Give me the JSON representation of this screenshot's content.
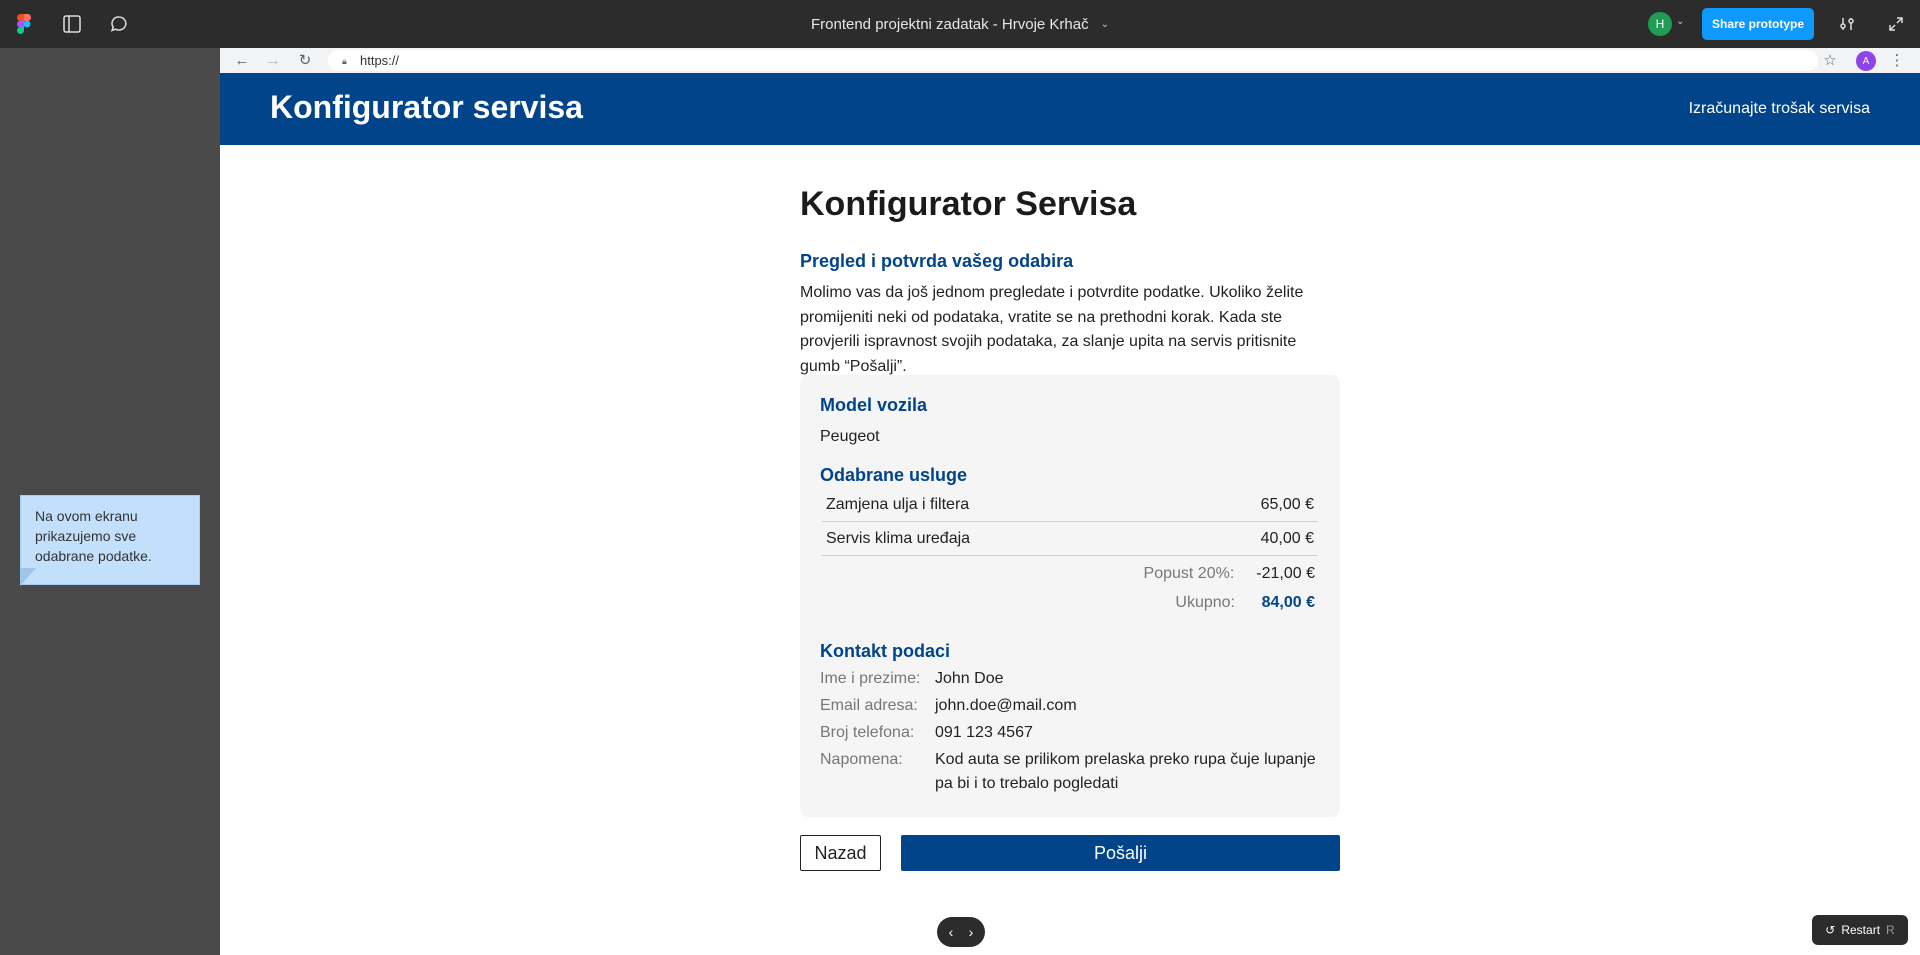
{
  "figma": {
    "file_title": "Frontend projektni zadatak - Hrvoje Krhač",
    "user_initial": "H",
    "share_label": "Share prototype",
    "restart_label": "Restart",
    "restart_key": "R"
  },
  "sticky_note": "Na ovom ekranu prikazujemo sve odabrane podatke.",
  "browser": {
    "url": "https://",
    "profile_initial": "A"
  },
  "site": {
    "brand": "Konfigurator servisa",
    "nav_link": "Izračunajte trošak servisa"
  },
  "page": {
    "title": "Konfigurator Servisa",
    "subtitle": "Pregled i potvrda vašeg odabira",
    "intro": "Molimo vas da još jednom pregledate i potvrdite podatke. Ukoliko želite promijeniti neki od podataka, vratite se na prethodni korak. Kada ste provjerili ispravnost svojih podataka, za slanje upita na servis pritisnite gumb “Pošalji”."
  },
  "summary": {
    "model_heading": "Model vozila",
    "model_value": "Peugeot",
    "services_heading": "Odabrane usluge",
    "services": [
      {
        "name": "Zamjena ulja i filtera",
        "price": "65,00 €"
      },
      {
        "name": "Servis klima uređaja",
        "price": "40,00 €"
      }
    ],
    "discount_label": "Popust 20%:",
    "discount_value": "-21,00 €",
    "total_label": "Ukupno:",
    "total_value": "84,00 €",
    "contact_heading": "Kontakt podaci",
    "contact": [
      {
        "label": "Ime i prezime:",
        "value": "John Doe"
      },
      {
        "label": "Email adresa:",
        "value": "john.doe@mail.com"
      },
      {
        "label": "Broj telefona:",
        "value": "091 123 4567"
      },
      {
        "label": "Napomena:",
        "value": "Kod auta se prilikom prelaska preko rupa čuje lupanje pa bi i to trebalo pogledati"
      }
    ]
  },
  "actions": {
    "back_label": "Nazad",
    "send_label": "Pošalji"
  },
  "colors": {
    "brand_blue": "#01448a",
    "figma_blue": "#0d99ff"
  }
}
